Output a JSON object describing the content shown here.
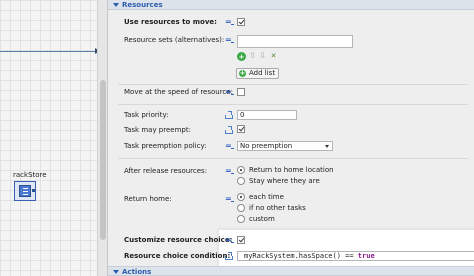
{
  "canvas": {
    "agent_label": "rackStore"
  },
  "panel": {
    "section_resources": "Resources",
    "section_actions": "Actions",
    "use_resources_to_move": {
      "label": "Use resources to move:",
      "checked": true
    },
    "resource_sets": {
      "label": "Resource sets (alternatives):",
      "add_list_label": "Add list"
    },
    "move_at_speed": {
      "label": "Move at the speed of resource:",
      "checked": false
    },
    "task_priority": {
      "label": "Task priority:",
      "value": "0"
    },
    "task_may_preempt": {
      "label": "Task may preempt:",
      "checked": true
    },
    "task_preemption_policy": {
      "label": "Task preemption policy:",
      "value": "No preemption"
    },
    "after_release": {
      "label": "After release resources:",
      "options": [
        "Return to home location",
        "Stay where they are"
      ],
      "selected": 0
    },
    "return_home": {
      "label": "Return home:",
      "options": [
        "each time",
        "if no other tasks",
        "custom"
      ],
      "selected": 0
    },
    "customize_resource_choice": {
      "label": "Customize resource choice:",
      "checked": true
    },
    "resource_choice_condition": {
      "label": "Resource choice condition:",
      "code_part": "myRackSystem.hasSpace() == ",
      "code_kw": "true"
    }
  }
}
